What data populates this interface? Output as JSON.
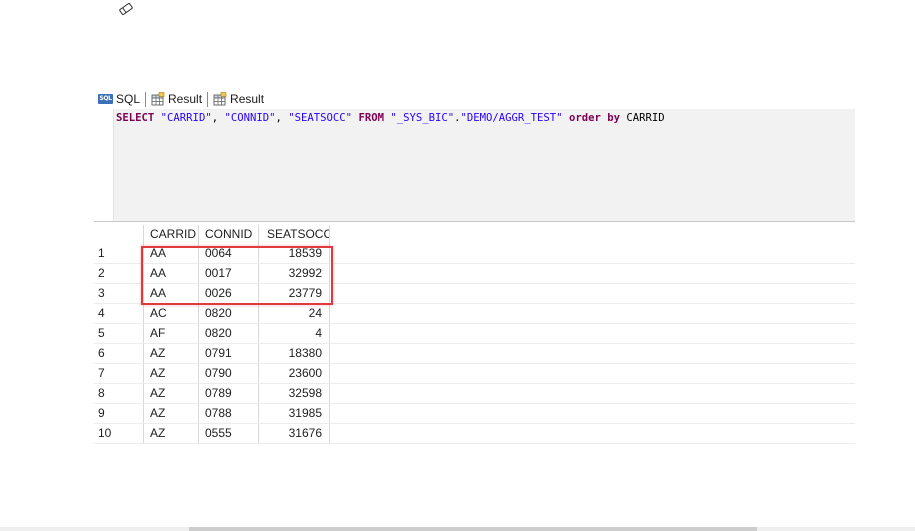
{
  "toolbar": {
    "eraser_icon": "eraser-icon"
  },
  "tabs": [
    {
      "label": "SQL",
      "icon": "sql-icon",
      "icon_text": "SQL"
    },
    {
      "label": "Result",
      "icon": "table-result-icon"
    },
    {
      "label": "Result",
      "icon": "table-result-icon"
    }
  ],
  "editor": {
    "query_parts": {
      "select": "SELECT",
      "col1": "\"CARRID\"",
      "comma1": ", ",
      "col2": "\"CONNID\"",
      "comma2": ", ",
      "col3": "\"SEATSOCC\"",
      "from": "FROM",
      "schema": "\"_SYS_BIC\"",
      "dot": ".",
      "view": "\"DEMO/AGGR_TEST\"",
      "order": "order",
      "by": "by",
      "orderby_col": "CARRID"
    }
  },
  "result": {
    "columns": [
      "CARRID",
      "CONNID",
      "SEATSOCC"
    ],
    "rows": [
      {
        "idx": "1",
        "carrid": "AA",
        "connid": "0064",
        "seatsocc": "18539"
      },
      {
        "idx": "2",
        "carrid": "AA",
        "connid": "0017",
        "seatsocc": "32992"
      },
      {
        "idx": "3",
        "carrid": "AA",
        "connid": "0026",
        "seatsocc": "23779"
      },
      {
        "idx": "4",
        "carrid": "AC",
        "connid": "0820",
        "seatsocc": "24"
      },
      {
        "idx": "5",
        "carrid": "AF",
        "connid": "0820",
        "seatsocc": "4"
      },
      {
        "idx": "6",
        "carrid": "AZ",
        "connid": "0791",
        "seatsocc": "18380"
      },
      {
        "idx": "7",
        "carrid": "AZ",
        "connid": "0790",
        "seatsocc": "23600"
      },
      {
        "idx": "8",
        "carrid": "AZ",
        "connid": "0789",
        "seatsocc": "32598"
      },
      {
        "idx": "9",
        "carrid": "AZ",
        "connid": "0788",
        "seatsocc": "31985"
      },
      {
        "idx": "10",
        "carrid": "AZ",
        "connid": "0555",
        "seatsocc": "31676"
      }
    ],
    "highlighted_rows": [
      1,
      2,
      3
    ]
  },
  "colors": {
    "keyword": "#7f0055",
    "string": "#2a00ff",
    "highlight_border": "#e0393e",
    "editor_bg": "#f2f2f2",
    "sql_icon_bg": "#3b6fb6"
  }
}
